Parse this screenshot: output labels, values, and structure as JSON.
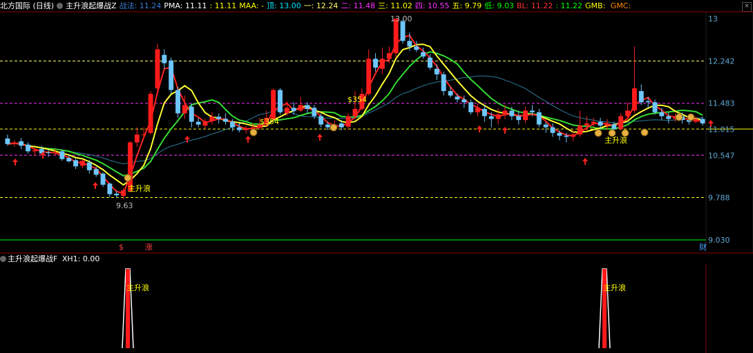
{
  "header": {
    "stock": "北方国际 (日线)",
    "indicator": "主升浪起爆战Z",
    "items": [
      {
        "k": "战法",
        "v": "11.24",
        "kc": "#3a7bd5",
        "vc": "#3a7bd5",
        "sep": ":"
      },
      {
        "k": "PMA",
        "v": "11.11",
        "kc": "#ffffff",
        "vc": "#ffffff",
        "sep": ":"
      },
      {
        "k": "",
        "v": "11.11",
        "kc": "#ffff00",
        "vc": "#ffff00",
        "sep": ":"
      },
      {
        "k": "MAA",
        "v": "-",
        "kc": "#ffff00",
        "vc": "#ffff00",
        "sep": ":"
      },
      {
        "k": "顶",
        "v": "13.00",
        "kc": "#00e5ff",
        "vc": "#00e5ff",
        "sep": ":"
      },
      {
        "k": "一",
        "v": "12.24",
        "kc": "#ffff66",
        "vc": "#ffff66",
        "sep": ":"
      },
      {
        "k": "二",
        "v": "11.48",
        "kc": "#ff33ff",
        "vc": "#ff33ff",
        "sep": ":"
      },
      {
        "k": "三",
        "v": "11.02",
        "kc": "#ffff00",
        "vc": "#ffff00",
        "sep": ":"
      },
      {
        "k": "四",
        "v": "10.55",
        "kc": "#ff33ff",
        "vc": "#ff33ff",
        "sep": ":"
      },
      {
        "k": "五",
        "v": "9.79",
        "kc": "#ffff00",
        "vc": "#ffff00",
        "sep": ":"
      },
      {
        "k": "低",
        "v": "9.03",
        "kc": "#00ff00",
        "vc": "#00ff00",
        "sep": ":"
      },
      {
        "k": "BL",
        "v": "11.22",
        "kc": "#ff3333",
        "vc": "#ff3333",
        "sep": ":"
      },
      {
        "k": "",
        "v": "11.22",
        "kc": "#00ff00",
        "vc": "#00ff00",
        "sep": ":"
      },
      {
        "k": "GMB",
        "v": "",
        "kc": "#ffff00",
        "vc": "#ffff00",
        "sep": ":"
      },
      {
        "k": "GMC",
        "v": "",
        "kc": "#ff8800",
        "vc": "#ff8800",
        "sep": ":"
      }
    ],
    "close_glyph": "×"
  },
  "sub_header": {
    "indicator": "主升浪起爆战F",
    "label": "XH1",
    "value": "0.00"
  },
  "chart_data": [
    {
      "type": "candlestick",
      "title": "北方国际 (日线)",
      "yticks": [
        "13",
        "12.242",
        "11.483",
        "11.015",
        "10.547",
        "9.788",
        "9.030"
      ],
      "levels": [
        {
          "name": "一",
          "value": 12.24,
          "color": "#ffff66"
        },
        {
          "name": "二",
          "value": 11.48,
          "color": "#ff33ff"
        },
        {
          "name": "三",
          "value": 11.02,
          "color": "#ffff00"
        },
        {
          "name": "四",
          "value": 10.55,
          "color": "#ff33ff"
        },
        {
          "name": "五",
          "value": 9.79,
          "color": "#ffff00"
        },
        {
          "name": "低",
          "value": 9.03,
          "color": "#00ff00"
        }
      ],
      "ylim": [
        9.03,
        13.0
      ],
      "candles": [
        [
          10.85,
          10.75,
          10.92,
          10.72
        ],
        [
          10.75,
          10.78,
          10.82,
          10.7
        ],
        [
          10.8,
          10.72,
          10.86,
          10.66
        ],
        [
          10.74,
          10.62,
          10.78,
          10.58
        ],
        [
          10.62,
          10.64,
          10.68,
          10.55
        ],
        [
          10.66,
          10.58,
          10.72,
          10.56
        ],
        [
          10.6,
          10.59,
          10.64,
          10.52
        ],
        [
          10.6,
          10.6,
          10.66,
          10.55
        ],
        [
          10.62,
          10.48,
          10.66,
          10.45
        ],
        [
          10.5,
          10.44,
          10.56,
          10.42
        ],
        [
          10.46,
          10.35,
          10.5,
          10.3
        ],
        [
          10.36,
          10.45,
          10.48,
          10.32
        ],
        [
          10.42,
          10.28,
          10.46,
          10.22
        ],
        [
          10.3,
          10.2,
          10.34,
          10.16
        ],
        [
          10.22,
          10.02,
          10.24,
          9.98
        ],
        [
          10.04,
          9.85,
          10.06,
          9.8
        ],
        [
          9.86,
          9.83,
          9.92,
          9.79
        ],
        [
          9.82,
          9.92,
          9.96,
          9.76
        ],
        [
          9.9,
          10.78,
          10.8,
          9.88
        ],
        [
          10.78,
          10.92,
          11.05,
          10.7
        ],
        [
          10.92,
          10.92,
          11.05,
          10.85
        ],
        [
          10.95,
          11.65,
          11.7,
          10.92
        ],
        [
          11.75,
          12.45,
          12.55,
          11.7
        ],
        [
          12.35,
          12.2,
          12.45,
          12.1
        ],
        [
          12.25,
          11.72,
          12.3,
          11.65
        ],
        [
          11.72,
          11.3,
          11.78,
          11.22
        ],
        [
          11.3,
          11.45,
          11.62,
          11.2
        ],
        [
          11.42,
          11.15,
          11.48,
          11.05
        ],
        [
          11.15,
          11.1,
          11.22,
          11.05
        ],
        [
          11.08,
          11.16,
          11.2,
          11.02
        ],
        [
          11.16,
          11.24,
          11.32,
          11.1
        ],
        [
          11.24,
          11.2,
          11.3,
          11.12
        ],
        [
          11.2,
          11.15,
          11.3,
          11.1
        ],
        [
          11.15,
          11.05,
          11.2,
          10.98
        ],
        [
          11.05,
          11.0,
          11.12,
          10.96
        ],
        [
          11.0,
          11.02,
          11.08,
          10.94
        ],
        [
          11.02,
          11.05,
          11.12,
          11.0
        ],
        [
          11.04,
          11.1,
          11.22,
          11.0
        ],
        [
          11.1,
          11.22,
          11.35,
          11.05
        ],
        [
          11.2,
          11.72,
          11.75,
          11.15
        ],
        [
          11.72,
          11.32,
          11.75,
          11.28
        ],
        [
          11.3,
          11.4,
          11.52,
          11.26
        ],
        [
          11.4,
          11.34,
          11.5,
          11.28
        ],
        [
          11.35,
          11.45,
          11.6,
          11.32
        ],
        [
          11.45,
          11.38,
          11.5,
          11.3
        ],
        [
          11.4,
          11.25,
          11.45,
          11.2
        ],
        [
          11.25,
          11.1,
          11.3,
          11.05
        ],
        [
          11.1,
          11.05,
          11.15,
          11.0
        ],
        [
          11.04,
          11.1,
          11.18,
          11.0
        ],
        [
          11.12,
          11.05,
          11.18,
          11.0
        ],
        [
          11.06,
          11.25,
          11.3,
          11.02
        ],
        [
          11.25,
          11.38,
          11.7,
          11.2
        ],
        [
          11.38,
          11.65,
          11.75,
          11.35
        ],
        [
          11.65,
          12.28,
          12.45,
          11.62
        ],
        [
          12.28,
          12.12,
          12.38,
          12.05
        ],
        [
          12.1,
          12.28,
          12.48,
          12.0
        ],
        [
          12.28,
          12.38,
          12.5,
          12.2
        ],
        [
          12.38,
          13.0,
          13.0,
          12.3
        ],
        [
          12.95,
          12.6,
          12.98,
          12.55
        ],
        [
          12.6,
          12.5,
          12.75,
          12.42
        ],
        [
          12.5,
          12.44,
          12.6,
          12.4
        ],
        [
          12.4,
          12.32,
          12.48,
          12.28
        ],
        [
          12.3,
          12.12,
          12.36,
          12.08
        ],
        [
          12.1,
          12.0,
          12.18,
          11.9
        ],
        [
          12.0,
          11.7,
          12.05,
          11.62
        ],
        [
          11.7,
          11.62,
          11.78,
          11.58
        ],
        [
          11.6,
          11.55,
          11.66,
          11.5
        ],
        [
          11.55,
          11.5,
          11.62,
          11.4
        ],
        [
          11.5,
          11.32,
          11.55,
          11.28
        ],
        [
          11.32,
          11.4,
          11.48,
          11.25
        ],
        [
          11.38,
          11.25,
          11.45,
          11.15
        ],
        [
          11.25,
          11.2,
          11.32,
          11.05
        ],
        [
          11.2,
          11.28,
          11.4,
          11.1
        ],
        [
          11.28,
          11.35,
          11.45,
          11.2
        ],
        [
          11.35,
          11.25,
          11.42,
          11.18
        ],
        [
          11.25,
          11.18,
          11.35,
          11.1
        ],
        [
          11.18,
          11.35,
          11.42,
          11.12
        ],
        [
          11.35,
          11.32,
          11.45,
          11.25
        ],
        [
          11.32,
          11.1,
          11.38,
          11.05
        ],
        [
          11.1,
          11.05,
          11.15,
          10.95
        ],
        [
          11.05,
          10.95,
          11.12,
          10.88
        ],
        [
          10.95,
          10.9,
          11.0,
          10.82
        ],
        [
          10.9,
          10.88,
          10.95,
          10.78
        ],
        [
          10.88,
          10.92,
          11.0,
          10.8
        ],
        [
          10.92,
          11.08,
          11.35,
          10.88
        ],
        [
          11.08,
          11.12,
          11.25,
          11.0
        ],
        [
          11.12,
          11.15,
          11.22,
          11.05
        ],
        [
          11.15,
          11.08,
          11.22,
          11.02
        ],
        [
          11.08,
          11.12,
          11.2,
          11.0
        ],
        [
          11.1,
          11.02,
          11.15,
          10.98
        ],
        [
          11.02,
          11.25,
          11.3,
          11.0
        ],
        [
          11.25,
          11.35,
          11.5,
          11.2
        ],
        [
          11.35,
          11.75,
          12.5,
          11.3
        ],
        [
          11.7,
          11.5,
          11.82,
          11.45
        ],
        [
          11.52,
          11.5,
          11.6,
          11.4
        ],
        [
          11.5,
          11.32,
          11.55,
          11.28
        ],
        [
          11.32,
          11.25,
          11.4,
          11.18
        ],
        [
          11.25,
          11.2,
          11.32,
          11.12
        ],
        [
          11.2,
          11.25,
          11.3,
          11.15
        ],
        [
          11.25,
          11.18,
          11.32,
          11.12
        ],
        [
          11.18,
          11.15,
          11.28,
          11.1
        ],
        [
          11.15,
          11.2,
          11.25,
          11.12
        ],
        [
          11.2,
          11.12,
          11.24,
          11.08
        ]
      ],
      "annotations": [
        {
          "text": "13.00",
          "color": "#bbbbbb"
        },
        {
          "text": "9.63",
          "color": "#bbbbbb"
        },
        {
          "text": "主升浪",
          "color": "#ffff00"
        },
        {
          "text": "主升浪",
          "color": "#ffff00"
        },
        {
          "text": "$354",
          "color": "#ffff00"
        },
        {
          "text": "$354",
          "color": "#ffff00"
        },
        {
          "text": "$",
          "color": "#ff4444"
        },
        {
          "text": "涨",
          "color": "#ff4444"
        },
        {
          "text": "财",
          "color": "#4aa3ff"
        }
      ]
    },
    {
      "type": "line",
      "title": "主升浪起爆战F",
      "series": [
        {
          "name": "XH1",
          "values": [
            0,
            1,
            0,
            1,
            0
          ]
        }
      ],
      "labels": [
        "主升浪",
        "主升浪"
      ]
    }
  ]
}
